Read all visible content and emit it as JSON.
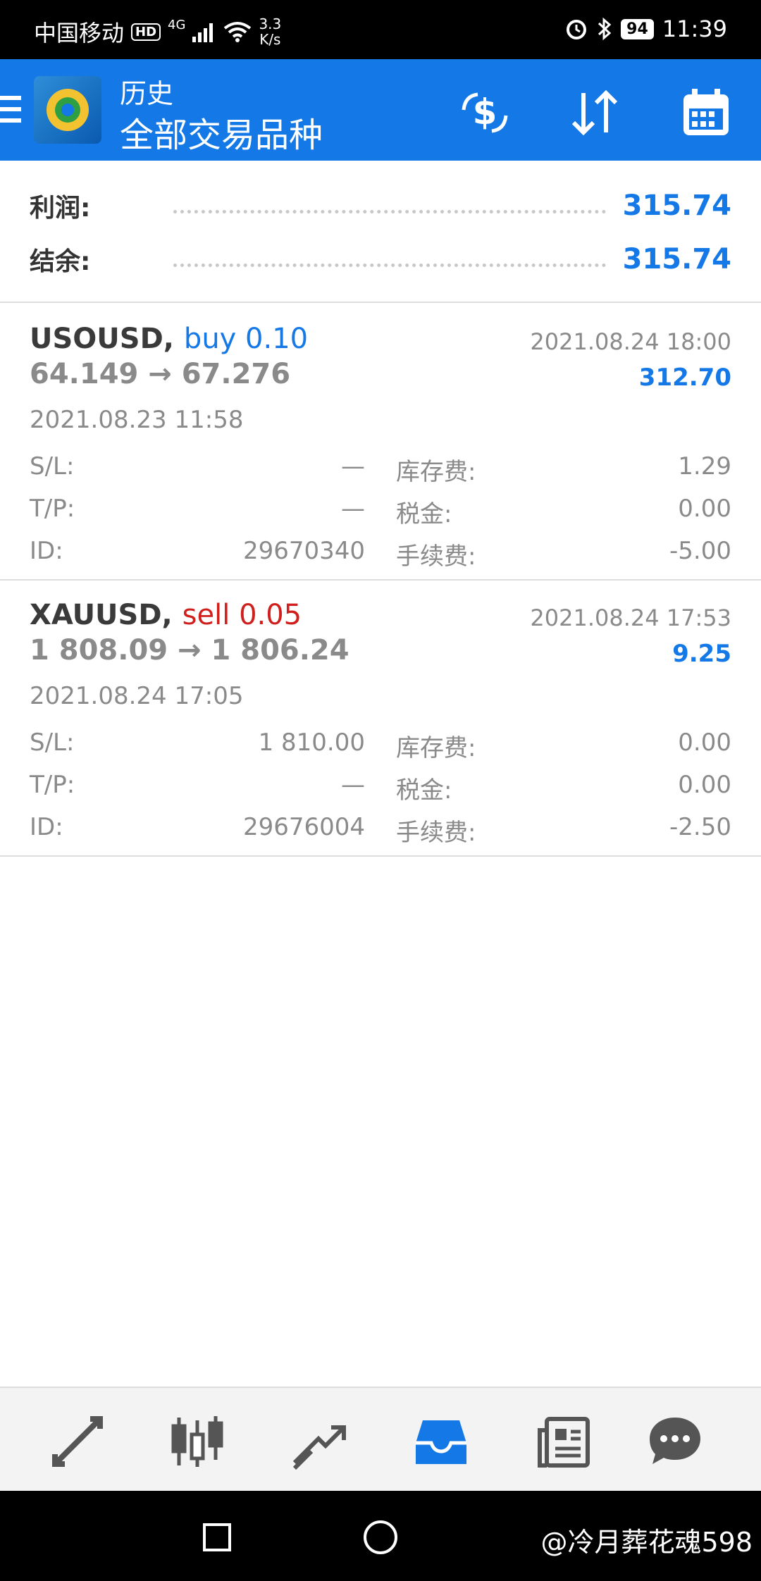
{
  "status_bar": {
    "carrier": "中国移动",
    "hd_badge": "HD",
    "network": "4G",
    "speed_value": "3.3",
    "speed_unit": "K/s",
    "battery": "94",
    "time": "11:39"
  },
  "header": {
    "section": "历史",
    "title": "全部交易品种"
  },
  "summary": {
    "profit_label": "利润:",
    "profit_value": "315.74",
    "balance_label": "结余:",
    "balance_value": "315.74"
  },
  "trades": [
    {
      "symbol": "USOUSD,",
      "side": "buy 0.10",
      "close_time": "2021.08.24 18:00",
      "prices": "64.149 → 67.276",
      "profit": "312.70",
      "open_time": "2021.08.23 11:58",
      "sl_label": "S/L:",
      "sl_value": "—",
      "tp_label": "T/P:",
      "tp_value": "—",
      "id_label": "ID:",
      "id_value": "29670340",
      "swap_label": "库存费:",
      "swap_value": "1.29",
      "tax_label": "税金:",
      "tax_value": "0.00",
      "fee_label": "手续费:",
      "fee_value": "-5.00"
    },
    {
      "symbol": "XAUUSD,",
      "side": "sell 0.05",
      "close_time": "2021.08.24 17:53",
      "prices": "1 808.09 → 1 806.24",
      "profit": "9.25",
      "open_time": "2021.08.24 17:05",
      "sl_label": "S/L:",
      "sl_value": "1 810.00",
      "tp_label": "T/P:",
      "tp_value": "—",
      "id_label": "ID:",
      "id_value": "29676004",
      "swap_label": "库存费:",
      "swap_value": "0.00",
      "tax_label": "税金:",
      "tax_value": "0.00",
      "fee_label": "手续费:",
      "fee_value": "-2.50"
    }
  ],
  "watermark": "@冷月葬花魂598",
  "colors": {
    "accent": "#1479e6",
    "sell": "#d0201e",
    "muted": "#8a8a8a"
  }
}
